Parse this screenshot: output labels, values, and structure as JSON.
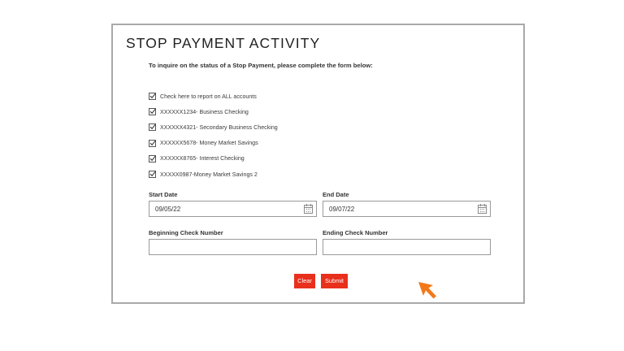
{
  "form": {
    "title": "STOP PAYMENT ACTIVITY",
    "subtitle": "To inquire on the status of a Stop Payment, please complete the form below:",
    "accounts": [
      {
        "label": "Check here to report on ALL accounts",
        "checked": true
      },
      {
        "label": "XXXXXX1234- Business Checking",
        "checked": true
      },
      {
        "label": "XXXXXX4321- Secondary Business Checking",
        "checked": true
      },
      {
        "label": "XXXXXX5678- Money Market Savings",
        "checked": true
      },
      {
        "label": "XXXXXX8765- Interest Checking",
        "checked": true
      },
      {
        "label": "XXXXX0987-Money Market Savings 2",
        "checked": true
      }
    ],
    "start_date": {
      "label": "Start Date",
      "value": "09/05/22"
    },
    "end_date": {
      "label": "End Date",
      "value": "09/07/22"
    },
    "beginning_check": {
      "label": "Beginning Check Number",
      "value": ""
    },
    "ending_check": {
      "label": "Ending Check Number",
      "value": ""
    },
    "clear_label": "Clear",
    "submit_label": "Submit"
  },
  "colors": {
    "button": "#e8301c",
    "cursor": "#f2791a",
    "panel_border": "#a9a9a9"
  },
  "icons": [
    "checkmark-icon",
    "calendar-icon",
    "mouse-pointer-icon"
  ]
}
